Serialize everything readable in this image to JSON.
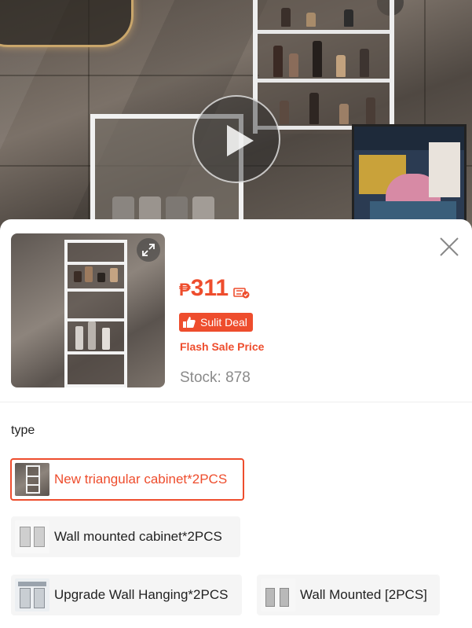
{
  "product": {
    "currency": "₱",
    "price": "311",
    "deal_badge": "Sulit Deal",
    "flash_label": "Flash Sale Price",
    "stock": "Stock: 878"
  },
  "variants_section": {
    "title": "type",
    "options": [
      {
        "label": "New triangular cabinet*2PCS",
        "selected": true
      },
      {
        "label": "Wall mounted cabinet*2PCS",
        "selected": false
      },
      {
        "label": "Upgrade Wall Hanging*2PCS",
        "selected": false
      },
      {
        "label": "Wall Mounted [2PCS]",
        "selected": false
      }
    ]
  },
  "colors": {
    "accent": "#ee4d2d",
    "stock_text": "#8a8a8a",
    "variant_bg": "#f5f5f5"
  },
  "icons": {
    "play": "play-icon",
    "close": "close-icon",
    "expand": "expand-icon",
    "voucher": "voucher-icon",
    "thumbs_up": "thumbs-up-icon"
  }
}
